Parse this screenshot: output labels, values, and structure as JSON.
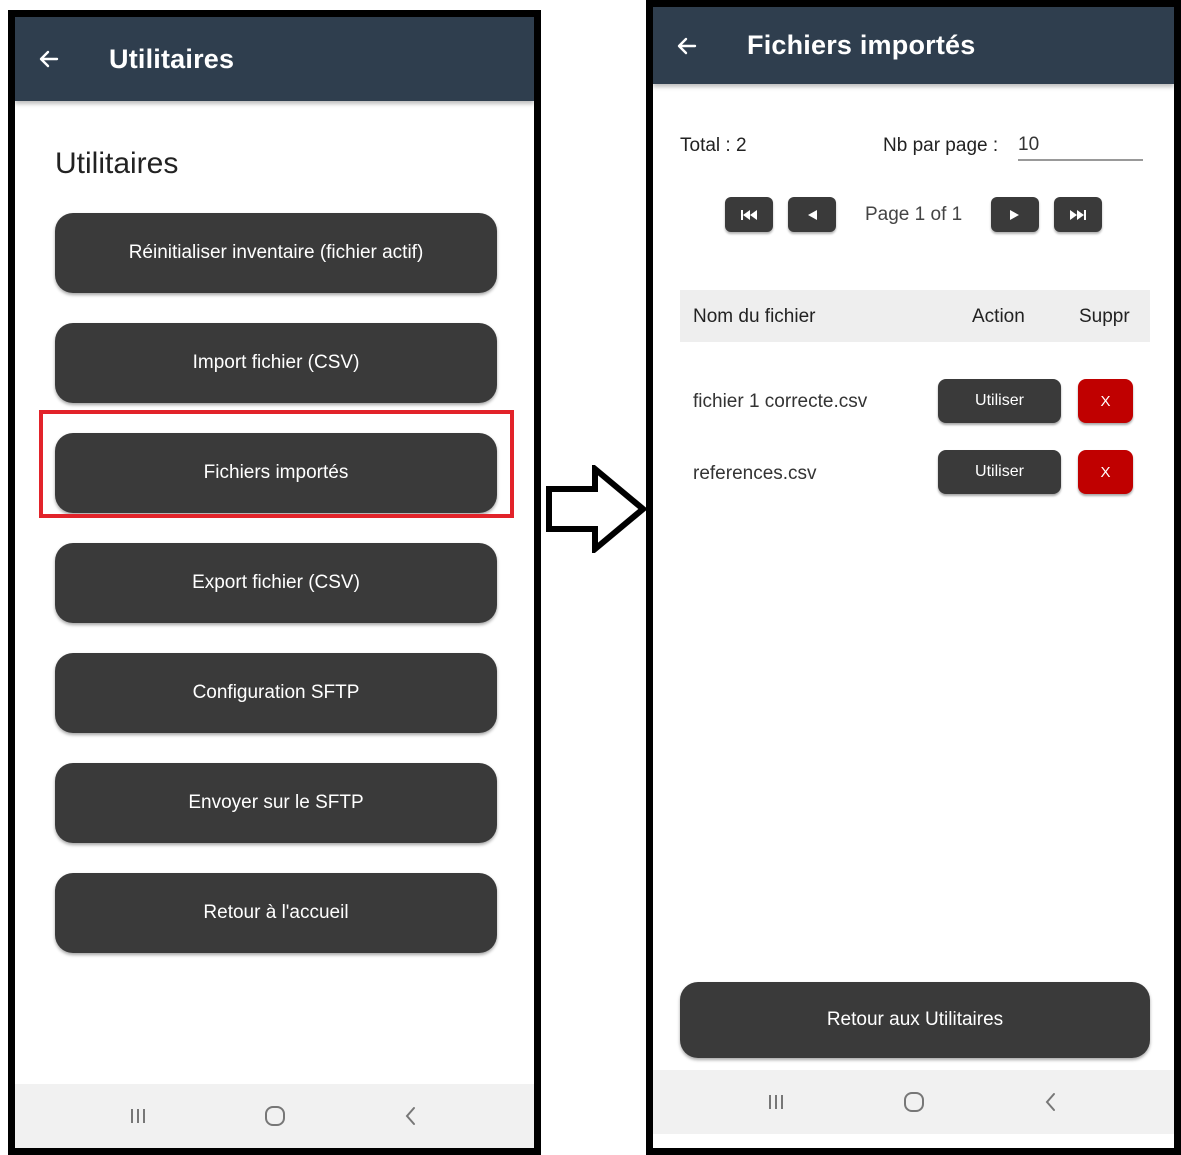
{
  "left_screen": {
    "appbar_title": "Utilitaires",
    "section_title": "Utilitaires",
    "menu_items": [
      {
        "label": "Réinitialiser inventaire (fichier actif)"
      },
      {
        "label": "Import fichier (CSV)"
      },
      {
        "label": "Fichiers importés",
        "highlighted": true
      },
      {
        "label": "Export fichier (CSV)"
      },
      {
        "label": "Configuration SFTP"
      },
      {
        "label": "Envoyer sur le SFTP"
      },
      {
        "label": "Retour à l'accueil"
      }
    ],
    "highlight_color": "#e2232a"
  },
  "right_screen": {
    "appbar_title": "Fichiers importés",
    "total_label": "Total : 2",
    "per_page_label": "Nb par page :",
    "per_page_value": "10",
    "page_info": "Page 1 of 1",
    "table_headers": {
      "name": "Nom du fichier",
      "action": "Action",
      "delete": "Suppr"
    },
    "rows": [
      {
        "name": "fichier 1 correcte.csv",
        "action_label": "Utiliser",
        "delete_label": "X"
      },
      {
        "name": "references.csv",
        "action_label": "Utiliser",
        "delete_label": "X"
      }
    ],
    "return_label": "Retour aux Utilitaires"
  },
  "colors": {
    "appbar": "#2f3e4e",
    "button": "#3a3a3a",
    "delete": "#c00000",
    "navbar": "#f1f1f1"
  },
  "icons": [
    "back-arrow-icon",
    "recents-icon",
    "home-icon",
    "back-nav-icon",
    "first-page-icon",
    "prev-page-icon",
    "next-page-icon",
    "last-page-icon",
    "flow-arrow-icon"
  ]
}
